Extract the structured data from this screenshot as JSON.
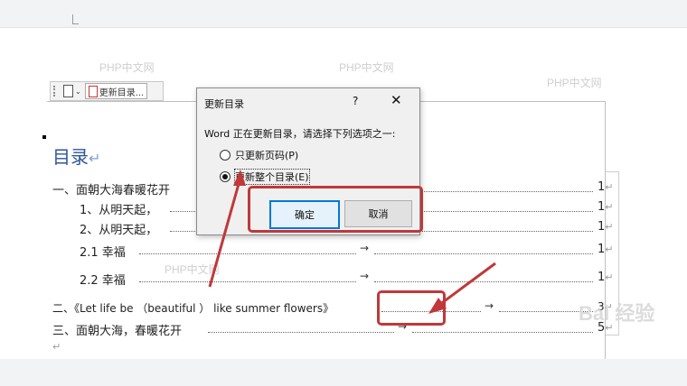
{
  "watermarks": [
    "PHP中文网",
    "PHP中文网",
    "PHP中文网",
    "PHP中文网"
  ],
  "baidu_watermark": "Bai 经验",
  "toolbar": {
    "toc_button_label": "更新目录..."
  },
  "document": {
    "toc_title": "目录",
    "para_mark": "↵",
    "tab_mark": "→",
    "entries": [
      {
        "text": "一、面朝大海春暖花开",
        "page": "1"
      },
      {
        "text": "1、从明天起，",
        "page": "1"
      },
      {
        "text": "2、从明天起，",
        "page": "1"
      },
      {
        "text": "2.1 幸福",
        "page": "1"
      },
      {
        "text": "2.2 幸福",
        "page": "1"
      },
      {
        "text": "二、《Let life be （beautiful ） like summer flowers》",
        "page": "3"
      },
      {
        "text": "三、面朝大海，春暖花开",
        "page": "5"
      }
    ]
  },
  "dialog": {
    "title": "更新目录",
    "help": "?",
    "close": "✕",
    "prompt": "Word 正在更新目录，请选择下列选项之一:",
    "option_page_numbers": "只更新页码(P)",
    "option_entire_table": "更新整个目录(E)",
    "ok_label": "确定",
    "cancel_label": "取消"
  },
  "colors": {
    "heading_blue": "#2e5597",
    "annotation_red": "#c0383a",
    "focus_blue": "#0078d7"
  }
}
